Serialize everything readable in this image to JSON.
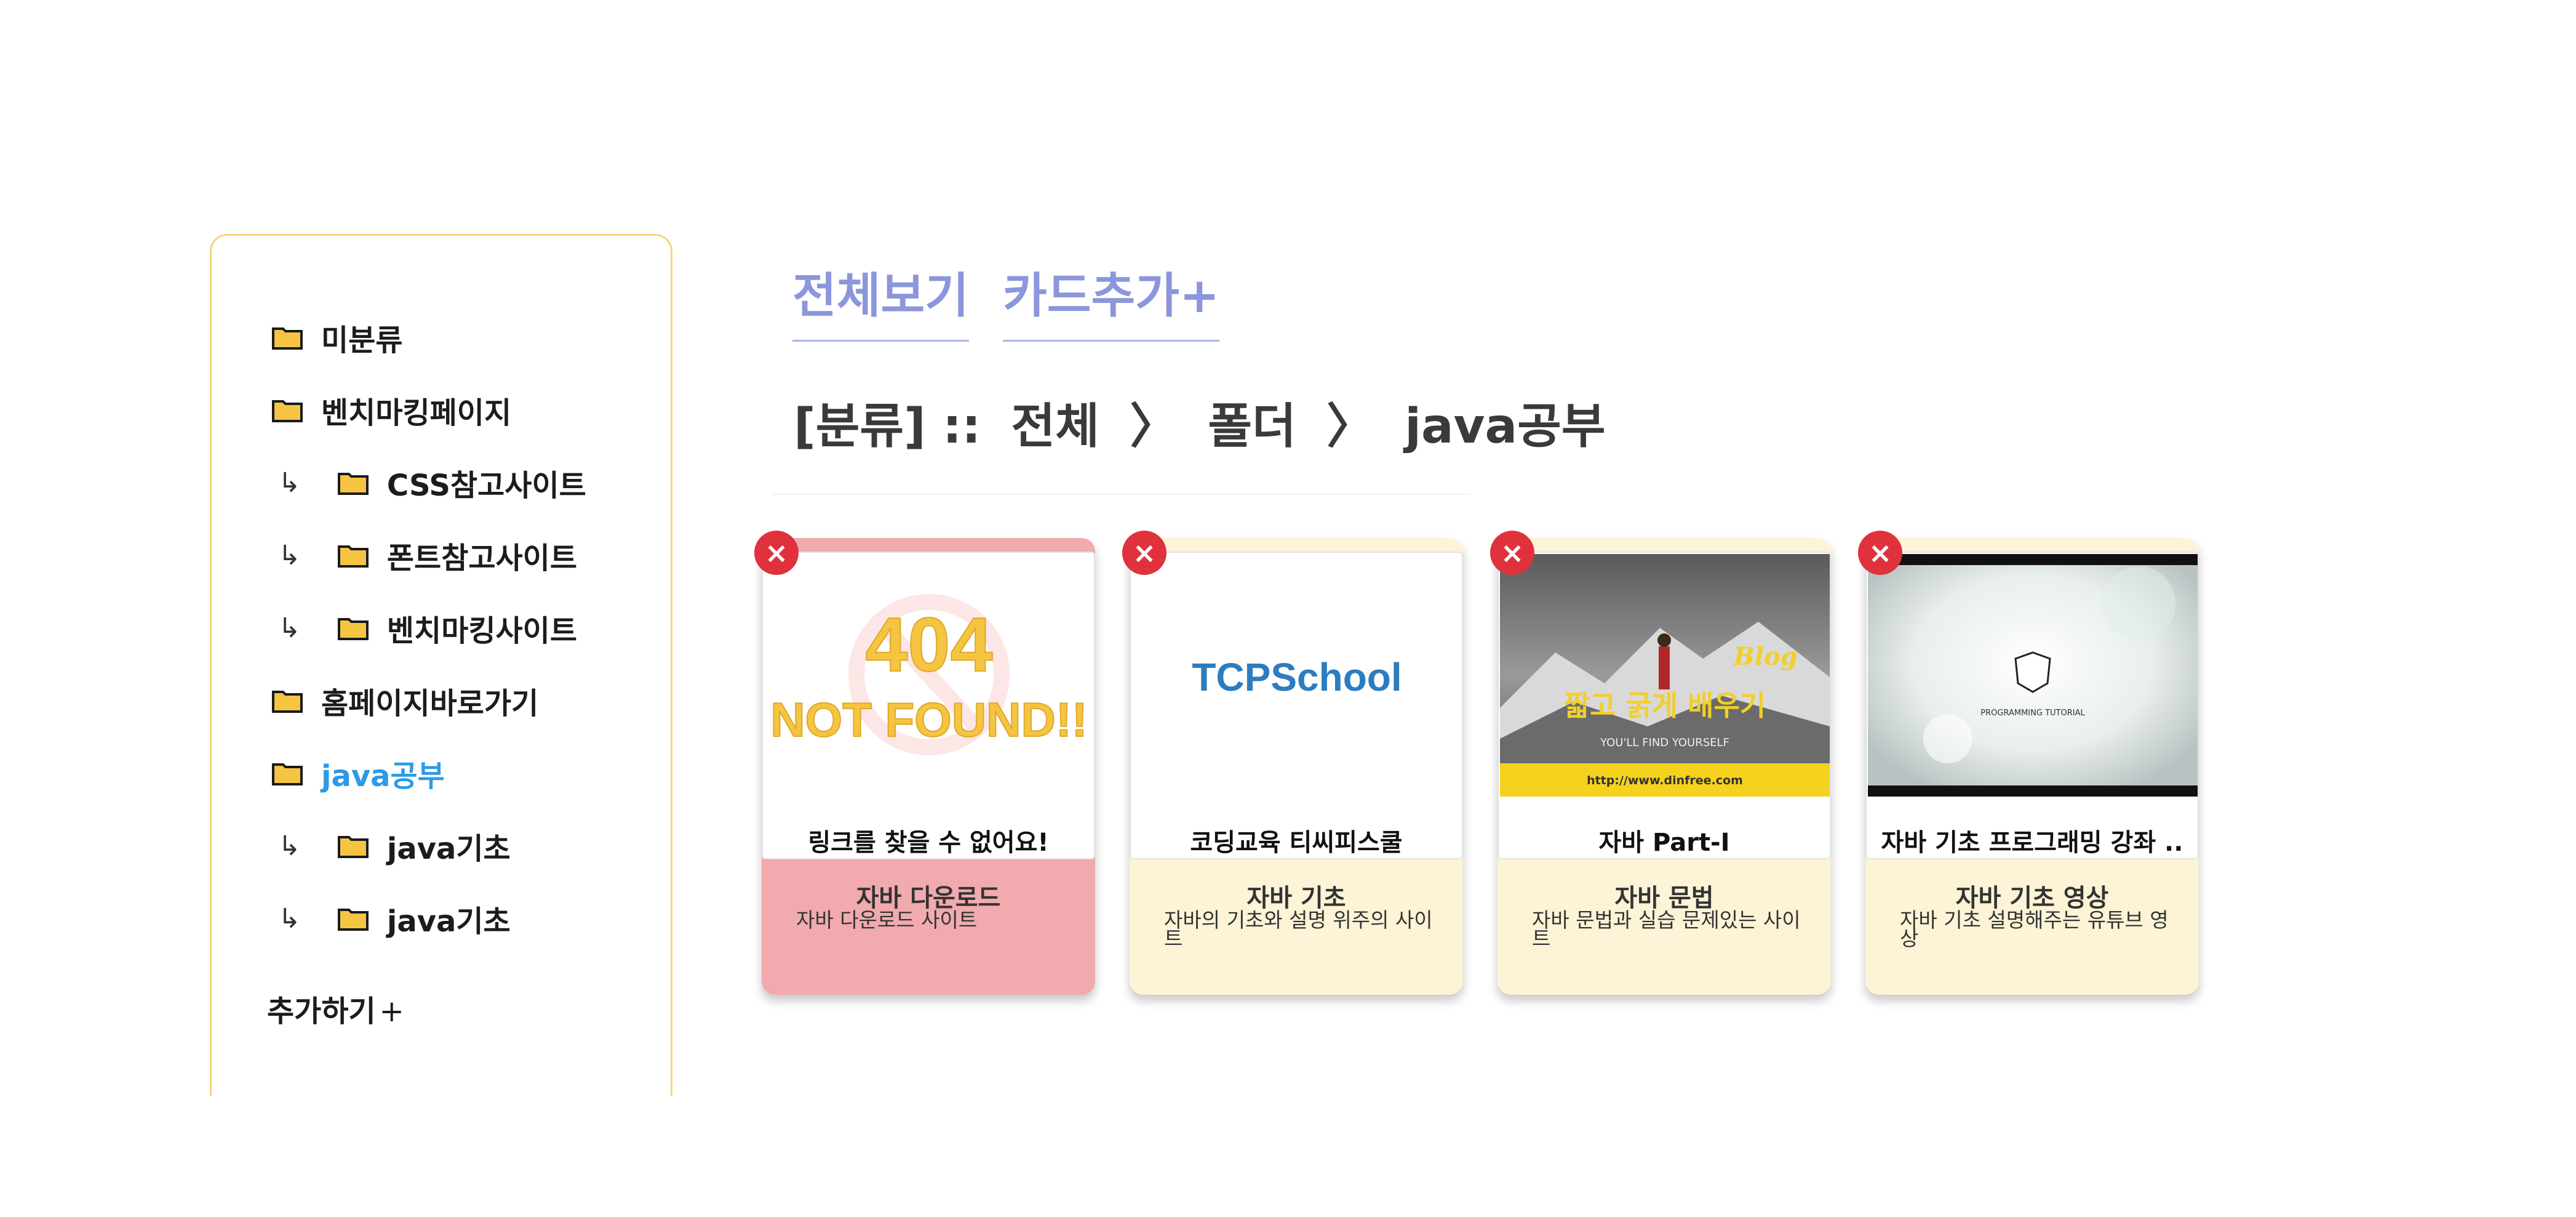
{
  "sidebar": {
    "items": [
      {
        "label": "미분류",
        "child": false,
        "active": false
      },
      {
        "label": "벤치마킹페이지",
        "child": false,
        "active": false
      },
      {
        "label": "CSS참고사이트",
        "child": true,
        "active": false
      },
      {
        "label": "폰트참고사이트",
        "child": true,
        "active": false
      },
      {
        "label": "벤치마킹사이트",
        "child": true,
        "active": false
      },
      {
        "label": "홈페이지바로가기",
        "child": false,
        "active": false
      },
      {
        "label": "java공부",
        "child": false,
        "active": true
      },
      {
        "label": "java기초",
        "child": true,
        "active": false
      },
      {
        "label": "java기초",
        "child": true,
        "active": false
      }
    ],
    "child_arrow": "↳",
    "add_label": "추가하기",
    "add_plus": "+"
  },
  "nav": {
    "view_all": "전체보기",
    "add_card": "카드추가+"
  },
  "breadcrumb": {
    "prefix": "[분류] ::",
    "root": "전체",
    "sep": "〉",
    "folder": "폴더",
    "current": "java공부"
  },
  "cards": [
    {
      "delete_label": "×",
      "thumb_text_top": "404",
      "thumb_text_bottom": "NOT FOUND!!",
      "link_title": "링크를 찾을 수 없어요!",
      "title": "자바 다운로드",
      "description": "자바 다운로드 사이트",
      "bg": "#f1aaad"
    },
    {
      "delete_label": "×",
      "thumb_text_top": "TCPSchool",
      "link_title": "코딩교육 티씨피스쿨",
      "title": "자바 기초",
      "description": "자바의 기초와 설명 위주의 사이트",
      "bg": "#fdf3d6"
    },
    {
      "delete_label": "×",
      "thumb_text_top": "Blog",
      "thumb_text_mid": "짧고 굵게 배우기",
      "thumb_text_small": "YOU'LL FIND YOURSELF",
      "thumb_text_url": "http://www.dinfree.com",
      "link_title": "자바 Part-I",
      "title": "자바 문법",
      "description": "자바 문법과 실습 문제있는 사이트",
      "bg": "#fdf3d6"
    },
    {
      "delete_label": "×",
      "thumb_text_top": "PROGRAMMING TUTORIAL",
      "link_title": "자바 기초 프로그래밍 강좌 ..",
      "title": "자바 기초 영상",
      "description": "자바 기초 설명해주는 유튜브 영상",
      "bg": "#fdf3d6"
    }
  ],
  "colors": {
    "accent_link": "#8b96dc",
    "active_folder": "#2e9ae6",
    "delete_red": "#e0323c",
    "folder_yellow": "#f5c542"
  }
}
